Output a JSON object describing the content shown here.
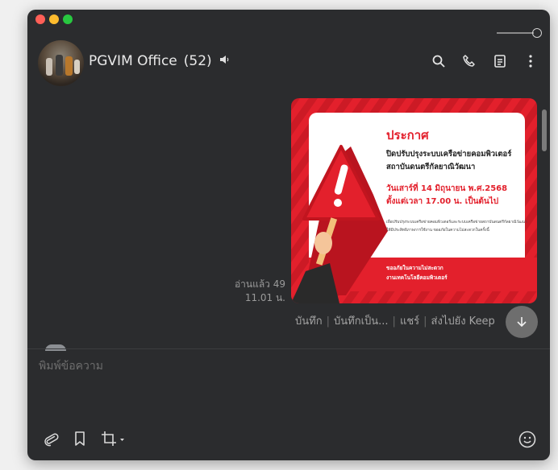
{
  "header": {
    "chat_name": "PGVIM Office",
    "member_count": "(52)",
    "icons": [
      "speaker-icon",
      "search-icon",
      "phone-icon",
      "notes-icon",
      "more-icon"
    ]
  },
  "message": {
    "read_label": "อ่านแล้ว 49",
    "time": "11.01 น.",
    "image": {
      "heading": "ประกาศ",
      "line1": "ปิดปรับปรุงระบบเครือข่ายคอมพิวเตอร์",
      "line2": "สถาบันดนตรีกัลยาณิวัฒนา",
      "date1": "วันเสาร์ที่ 14 มิถุนายน พ.ศ.2568",
      "date2": "ตั้งแต่เวลา 17.00 น. เป็นต้นไป",
      "small1": "เพื่อปรับปรุงระบบเครือข่ายคอมพิวเตอร์และระบบเครือข่ายสถาบันดนตรีกัลยาณิวัฒนา",
      "small2": "ให้มีประสิทธิภาพการใช้งาน ขออภัยในความไม่สะดวกในครั้งนี้",
      "banner1": "ขออภัยในความไม่สะดวก",
      "banner2": "งานเทคโนโลยีคอมพิวเตอร์"
    },
    "actions": [
      "บันทึก",
      "บันทึกเป็น...",
      "แชร์",
      "ส่งไปยัง Keep"
    ]
  },
  "composer": {
    "placeholder": "พิมพ์ข้อความ"
  },
  "colors": {
    "window_bg": "#2b2c2e",
    "accent_red": "#e3202c",
    "text": "#e9e9e9",
    "muted": "#9a9a9a"
  }
}
